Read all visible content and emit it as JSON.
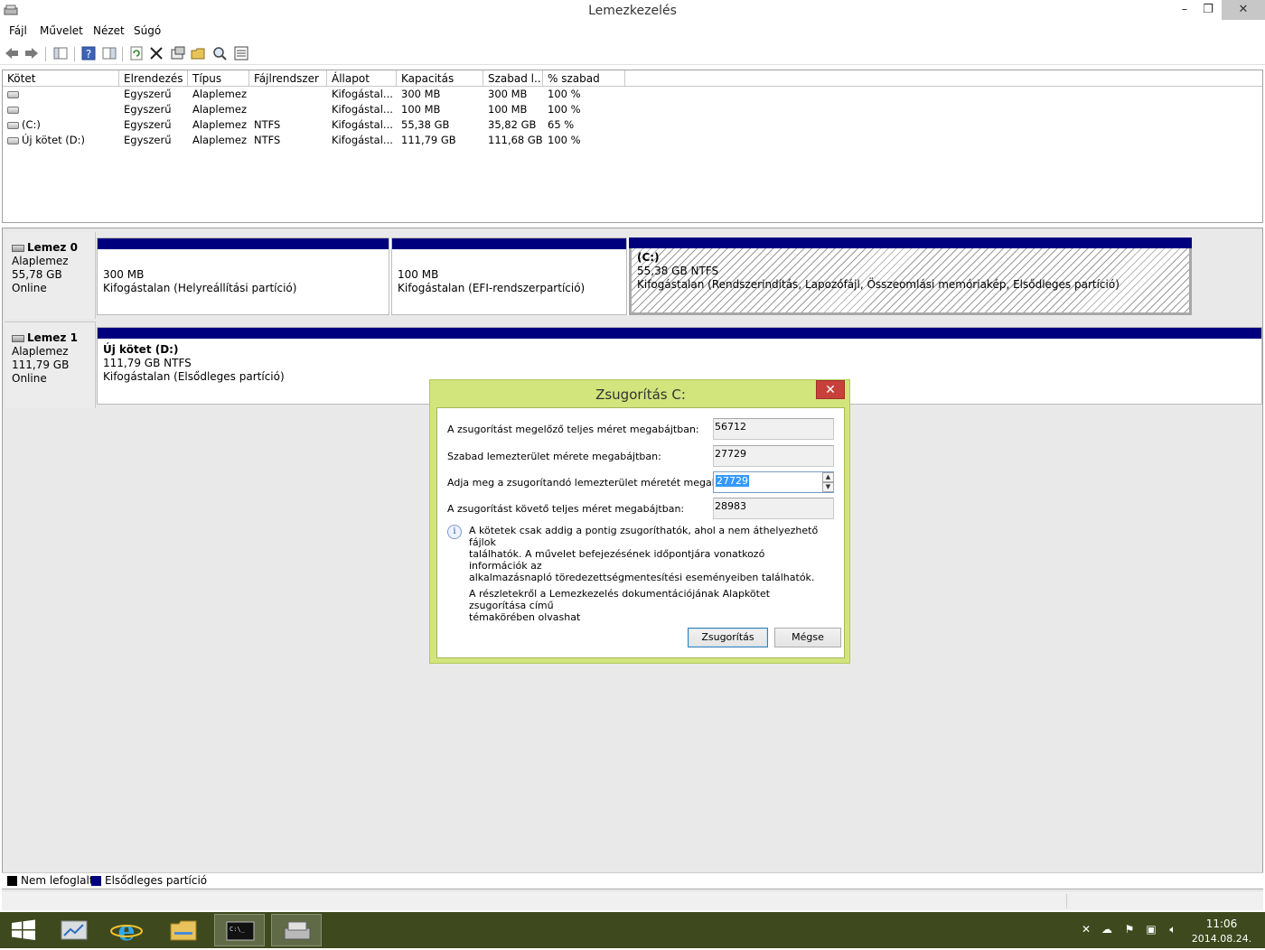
{
  "window": {
    "title": "Lemezkezelés",
    "minimize_glyph": "–",
    "restore_glyph": "❐",
    "close_glyph": "✕"
  },
  "menu": [
    "Fájl",
    "Művelet",
    "Nézet",
    "Súgó"
  ],
  "toolbar": {
    "icons": [
      "back-arrow-icon",
      "forward-arrow-icon",
      "console-tree-icon",
      "help-icon",
      "properties-pane-icon",
      "refresh-icon",
      "delete-icon",
      "properties-icon",
      "open-folder-icon",
      "search-icon",
      "settings-list-icon"
    ]
  },
  "volume_table": {
    "columns": [
      "Kötet",
      "Elrendezés",
      "Típus",
      "Fájlrendszer",
      "Állapot",
      "Kapacitás",
      "Szabad l...",
      "% szabad"
    ],
    "rows": [
      {
        "volume": "",
        "layout": "Egyszerű",
        "type": "Alaplemez",
        "fs": "",
        "status": "Kifogástal...",
        "capacity": "300 MB",
        "free": "300 MB",
        "pct": "100 %"
      },
      {
        "volume": "",
        "layout": "Egyszerű",
        "type": "Alaplemez",
        "fs": "",
        "status": "Kifogástal...",
        "capacity": "100 MB",
        "free": "100 MB",
        "pct": "100 %"
      },
      {
        "volume": "(C:)",
        "layout": "Egyszerű",
        "type": "Alaplemez",
        "fs": "NTFS",
        "status": "Kifogástal...",
        "capacity": "55,38 GB",
        "free": "35,82 GB",
        "pct": "65 %"
      },
      {
        "volume": "Új kötet (D:)",
        "layout": "Egyszerű",
        "type": "Alaplemez",
        "fs": "NTFS",
        "status": "Kifogástal...",
        "capacity": "111,79 GB",
        "free": "111,68 GB",
        "pct": "100 %"
      }
    ]
  },
  "disks": [
    {
      "name": "Lemez 0",
      "kind": "Alaplemez",
      "size": "55,78 GB",
      "status": "Online",
      "partitions": [
        {
          "title": "",
          "size": "300 MB",
          "desc": "Kifogástalan (Helyreállítási partíció)"
        },
        {
          "title": "",
          "size": "100 MB",
          "desc": "Kifogástalan (EFI-rendszerpartíció)"
        },
        {
          "title": "(C:)",
          "size": "55,38 GB NTFS",
          "desc": "Kifogástalan (Rendszerindítás, Lapozófájl, Összeomlási memóriakép, Elsődleges partíció)"
        }
      ]
    },
    {
      "name": "Lemez 1",
      "kind": "Alaplemez",
      "size": "111,79 GB",
      "status": "Online",
      "partitions": [
        {
          "title": "Új kötet  (D:)",
          "size": "111,79 GB NTFS",
          "desc": "Kifogástalan (Elsődleges partíció)"
        }
      ]
    }
  ],
  "legend": {
    "unallocated": "Nem lefoglalt",
    "primary": "Elsődleges partíció",
    "unallocated_color": "#000000",
    "primary_color": "#00007f"
  },
  "dialog": {
    "title": "Zsugorítás C:",
    "close_glyph": "✕",
    "total_before_label": "A zsugorítást megelőző teljes méret megabájtban:",
    "total_before_value": "56712",
    "free_label": "Szabad lemezterület mérete megabájtban:",
    "free_value": "27729",
    "shrink_label": "Adja meg a zsugorítandó lemezterület méretét megabájtban:",
    "shrink_value": "27729",
    "total_after_label": "A zsugorítást követő teljes méret megabájtban:",
    "total_after_value": "28983",
    "info_line1": "A kötetek csak addig a pontig zsugoríthatók, ahol a nem áthelyezhető fájlok",
    "info_line2": "találhatók. A művelet befejezésének időpontjára vonatkozó információk az",
    "info_line3": "alkalmazásnapló töredezettségmentesítési eseményeiben találhatók.",
    "doc_line1": "A részletekről a Lemezkezelés dokumentációjának Alapkötet zsugorítása című",
    "doc_line2": "témakörében olvashat",
    "shrink_button": "Zsugorítás",
    "cancel_button": "Mégse"
  },
  "taskbar": {
    "apps": [
      "start-icon",
      "server-manager-icon",
      "internet-explorer-icon",
      "file-explorer-icon",
      "command-prompt-icon",
      "disk-management-icon"
    ],
    "time": "11:06",
    "date": "2014.08.24."
  },
  "colors": {
    "partition_bar": "#00007f",
    "dialog_frame": "#d2e47c",
    "taskbar": "#3e4a1e"
  }
}
